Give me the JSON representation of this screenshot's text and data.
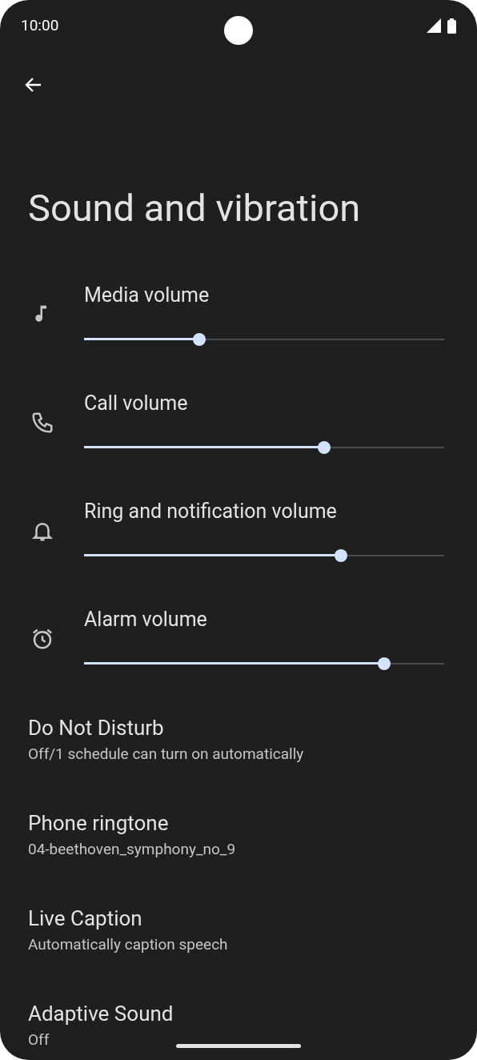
{
  "status_bar": {
    "time": "10:00"
  },
  "title": "Sound and vibration",
  "volume_sliders": [
    {
      "label": "Media volume",
      "level": 0.32
    },
    {
      "label": "Call volume",
      "level": 0.667
    },
    {
      "label": "Ring and notification volume",
      "level": 0.713
    },
    {
      "label": "Alarm volume",
      "level": 0.833
    }
  ],
  "items": [
    {
      "title": "Do Not Disturb",
      "subtitle": "Off/1 schedule can turn on automatically"
    },
    {
      "title": "Phone ringtone",
      "subtitle": "04-beethoven_symphony_no_9"
    },
    {
      "title": "Live Caption",
      "subtitle": "Automatically caption speech"
    },
    {
      "title": "Adaptive Sound",
      "subtitle": "Off"
    }
  ]
}
